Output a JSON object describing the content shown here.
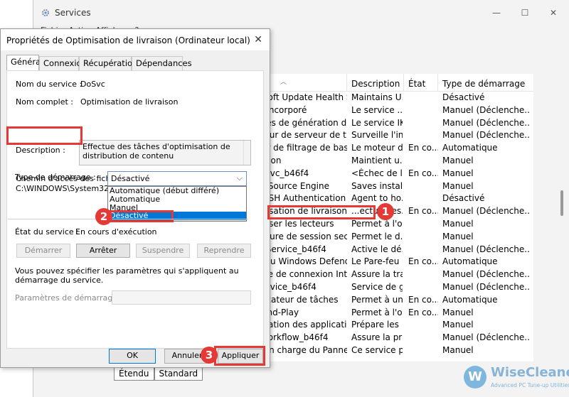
{
  "services_window": {
    "title": "Services",
    "menu": "Fichier   Action   Affichage   ?",
    "columns": {
      "name": "om",
      "description": "Description",
      "state": "État",
      "startup": "Type de démarrage"
    },
    "rows": [
      {
        "name": "Microsoft Update Health Se...",
        "description": "Maintains U...",
        "state": "",
        "startup": "Désactivé"
      },
      {
        "name": "Mode incorporé",
        "description": "Le service ...",
        "state": "",
        "startup": "Manuel (Déclenche..."
      },
      {
        "name": "Modules de génération de c...",
        "description": "Le service IK...",
        "state": "",
        "startup": "Manuel (Déclenche..."
      },
      {
        "name": "Moniteur de serveur de tra...",
        "description": "Surveille l'in...",
        "state": "",
        "startup": "Manuel (Déclenche..."
      },
      {
        "name": "Moteur de filtrage de base",
        "description": "Le moteur d...",
        "state": "En co...",
        "startup": "Automatique"
      },
      {
        "name": "NetLogon",
        "description": "Maintient u...",
        "state": "",
        "startup": "Manuel"
      },
      {
        "name": "NPSMSvc_b46f4",
        "description": "<Échec de l...",
        "state": "En co...",
        "startup": "Manuel"
      },
      {
        "name": "Office  Source Engine",
        "description": "Saves install...",
        "state": "",
        "startup": "Manuel"
      },
      {
        "name": "OpenSSH Authentication A...",
        "description": "Agent to ho...",
        "state": "",
        "startup": "Désactivé"
      },
      {
        "name": "Optimisation de livraison",
        "description": "...ectue des...",
        "state": "En co...",
        "startup": "Manuel (Déclenche..."
      },
      {
        "name": "Optimiser les lecteurs",
        "description": "Permet à l'o...",
        "state": "",
        "startup": "Manuel"
      },
      {
        "name": "Ouverture de session secon...",
        "description": "Permet le d...",
        "state": "",
        "startup": "Manuel"
      },
      {
        "name": "P9RdrService_b46f4",
        "description": "Active le dé...",
        "state": "",
        "startup": "Manuel (Déclenche..."
      },
      {
        "name": "Pare-feu Windows Defender",
        "description": "Le Pare-feu ...",
        "state": "En co...",
        "startup": "Automatique"
      },
      {
        "name": "Partage de connexion Inter...",
        "description": "Assure la tra...",
        "state": "",
        "startup": "Manuel (Déclenche..."
      },
      {
        "name": "PenService_b46f4",
        "description": "Service de g...",
        "state": "",
        "startup": "Manuel (Déclenche..."
      },
      {
        "name": "Planificateur de tâches",
        "description": "Permet à un...",
        "state": "En co...",
        "startup": "Automatique"
      },
      {
        "name": "Plug-and-Play",
        "description": "Permet à l'o...",
        "state": "En co...",
        "startup": "Manuel"
      },
      {
        "name": "Préparation des applications",
        "description": "Prépare les ...",
        "state": "",
        "startup": "Manuel"
      },
      {
        "name": "PrintWorkflow_b46f4",
        "description": "Assure la pri...",
        "state": "",
        "startup": "Manuel (Déclenche..."
      },
      {
        "name": "Prise en charge du Panneau...",
        "description": "Ce service p...",
        "state": "",
        "startup": "Manuel"
      }
    ],
    "bottom_tabs": {
      "extended": "Étendu",
      "standard": "Standard"
    }
  },
  "dialog": {
    "title": "Propriétés de Optimisation de livraison (Ordinateur local)",
    "tabs": {
      "general": "Général",
      "connexion": "Connexion",
      "recovery": "Récupération",
      "dependencies": "Dépendances"
    },
    "service_name_label": "Nom du service :",
    "service_name": "DoSvc",
    "display_name_label": "Nom complet :",
    "display_name": "Optimisation de livraison",
    "description_label": "Description :",
    "description": "Effectue des tâches d'optimisation de distribution de contenu",
    "path_label": "Chemin d'accès des fichiers exécutables :",
    "path": "C:\\WINDOWS\\System32\\svchost.exe -k NetworkService -p",
    "startup_type_label": "Type de démarrage :",
    "startup_type_value": "Désactivé",
    "startup_options": [
      "Automatique (début différé)",
      "Automatique",
      "Manuel",
      "Désactivé"
    ],
    "status_label": "État du service :",
    "status_value": "En cours d'exécution",
    "btn_start": "Démarrer",
    "btn_stop": "Arrêter",
    "btn_suspend": "Suspendre",
    "btn_resume": "Reprendre",
    "info_text": "Vous pouvez spécifier les paramètres qui s'appliquent au démarrage du service.",
    "params_label": "Paramètres de démarrage :",
    "btn_ok": "OK",
    "btn_cancel": "Annuler",
    "btn_apply": "Appliquer"
  },
  "annotations": {
    "step1": "1",
    "step2": "2",
    "step3": "3",
    "color": "#e53935"
  },
  "watermark": {
    "logo": "W",
    "name": "WiseCleaner",
    "tagline": "Advanced PC Tune-up Utilities"
  }
}
